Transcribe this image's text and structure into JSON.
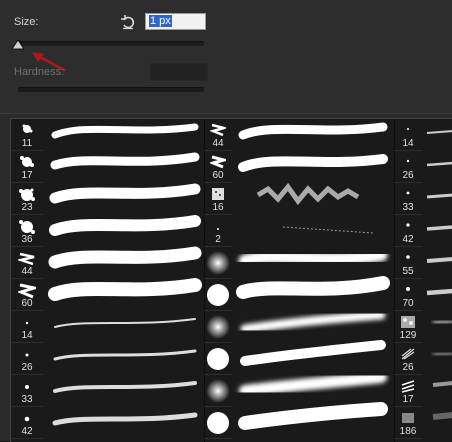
{
  "size": {
    "label": "Size:",
    "value": "1 px"
  },
  "hardness": {
    "label": "Hardness:"
  },
  "brushes": {
    "column1": [
      "11",
      "17",
      "23",
      "36",
      "44",
      "60",
      "14",
      "26",
      "33",
      "42"
    ],
    "column2": [
      "44",
      "60",
      "16",
      "2",
      "",
      "",
      "",
      "",
      "",
      ""
    ],
    "column3": [
      "14",
      "26",
      "33",
      "42",
      "55",
      "70",
      "129",
      "26",
      "17",
      "186"
    ]
  },
  "colors": {
    "selection": "#2f64c8",
    "arrow": "#b01818"
  }
}
